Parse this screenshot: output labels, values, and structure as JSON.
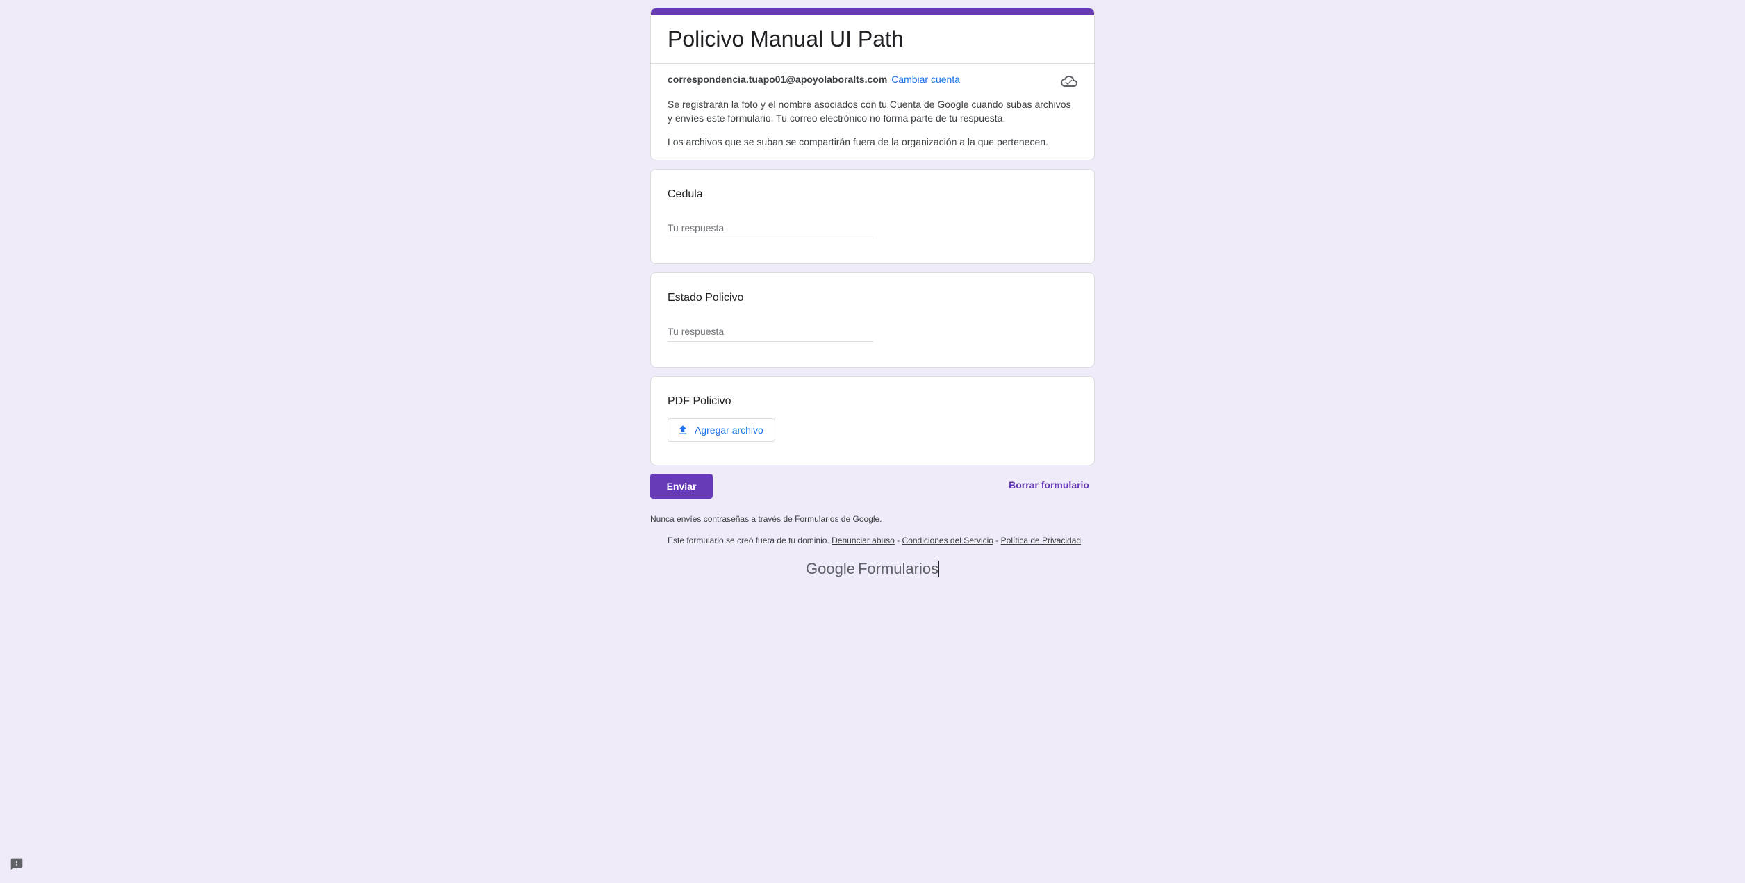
{
  "form": {
    "title": "Policivo Manual UI Path",
    "accent_color": "#673ab7",
    "background_color": "#f0ebf8",
    "account": {
      "email": "correspondencia.tuapo01@apoyolaboralts.com",
      "switch_label": "Cambiar cuenta",
      "cloud_icon": "cloud-saved-icon"
    },
    "notices": [
      "Se registrarán la foto y el nombre asociados con tu Cuenta de Google cuando subas archivos y envíes este formulario. Tu correo electrónico no forma parte de tu respuesta.",
      "Los archivos que se suban se compartirán fuera de la organización a la que pertenecen."
    ]
  },
  "questions": [
    {
      "title": "Cedula",
      "placeholder": "Tu respuesta"
    },
    {
      "title": "Estado Policivo",
      "placeholder": "Tu respuesta"
    }
  ],
  "file_question": {
    "title": "PDF Policivo",
    "button_label": "Agregar archivo",
    "icon": "upload-icon"
  },
  "actions": {
    "submit_label": "Enviar",
    "clear_label": "Borrar formulario"
  },
  "footer": {
    "warning": "Nunca envíes contraseñas a través de Formularios de Google.",
    "domain_note": "Este formulario se creó fuera de tu dominio.",
    "report_abuse": "Denunciar abuso",
    "separator": "-",
    "terms": "Condiciones del Servicio",
    "privacy": "Política de Privacidad",
    "brand_google": "Google",
    "brand_forms": "Formularios"
  },
  "report_icon": "feedback-icon"
}
